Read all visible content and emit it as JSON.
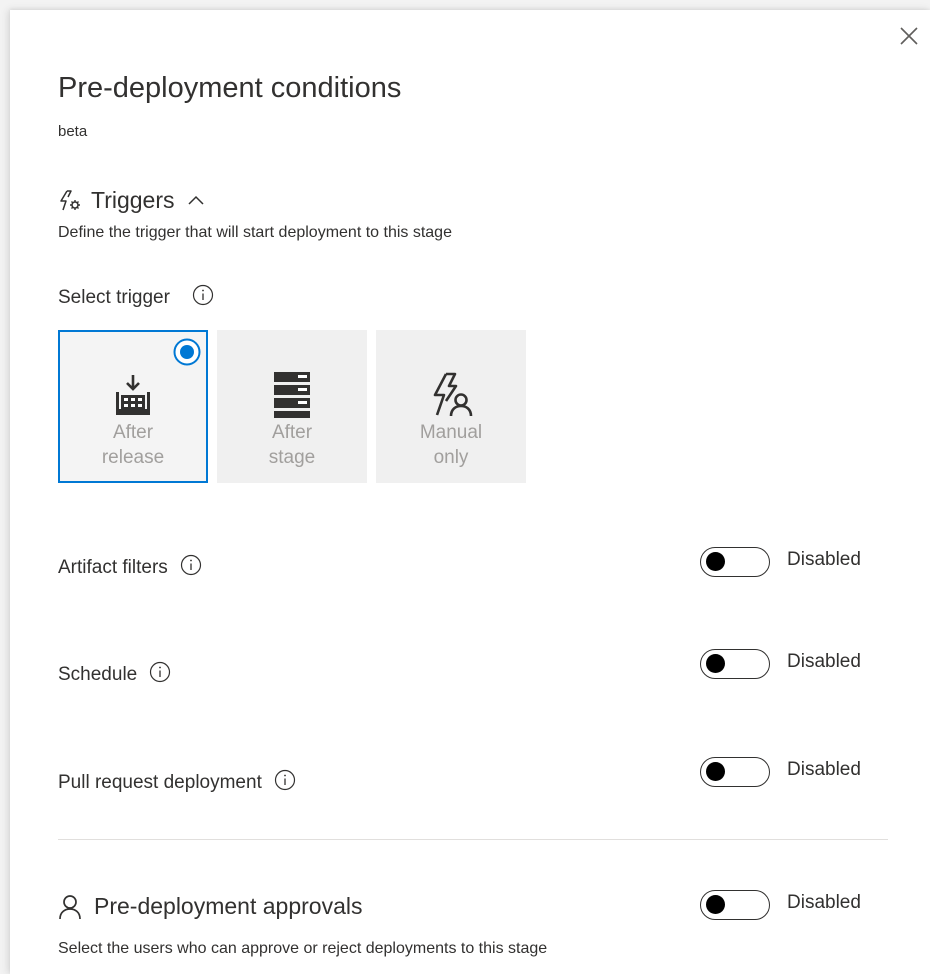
{
  "panel": {
    "title": "Pre-deployment conditions",
    "subtitle": "beta"
  },
  "triggers": {
    "heading": "Triggers",
    "description": "Define the trigger that will start deployment to this stage",
    "select_label": "Select trigger",
    "options": [
      {
        "line1": "After",
        "line2": "release",
        "selected": true,
        "icon": "after-release-icon"
      },
      {
        "line1": "After",
        "line2": "stage",
        "selected": false,
        "icon": "after-stage-icon"
      },
      {
        "line1": "Manual",
        "line2": "only",
        "selected": false,
        "icon": "manual-only-icon"
      }
    ]
  },
  "settings": {
    "artifact_filters": {
      "label": "Artifact filters",
      "state": "Disabled"
    },
    "schedule": {
      "label": "Schedule",
      "state": "Disabled"
    },
    "pull_request": {
      "label": "Pull request deployment",
      "state": "Disabled"
    }
  },
  "approvals": {
    "heading": "Pre-deployment approvals",
    "state": "Disabled",
    "description": "Select the users who can approve or reject deployments to this stage"
  },
  "colors": {
    "accent": "#0078d4",
    "text": "#323130",
    "tile_label": "#a19f9d",
    "tile_bg": "#f0f0f0"
  }
}
